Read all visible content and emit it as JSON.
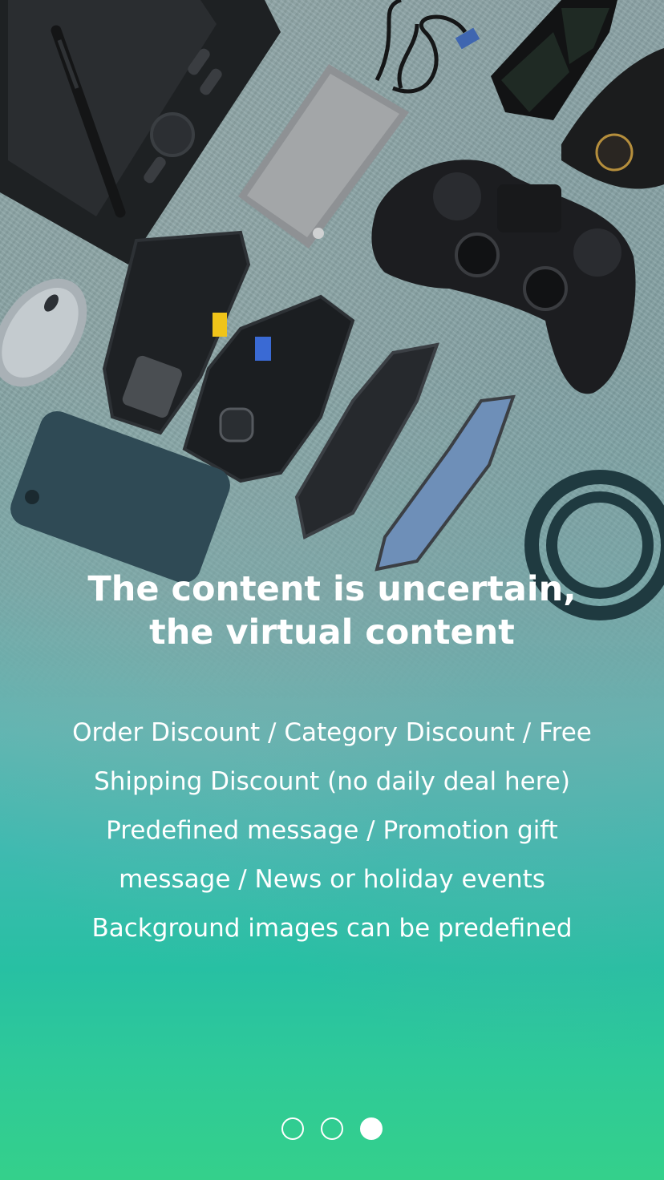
{
  "onboarding": {
    "title_line1": "The content is uncertain,",
    "title_line2": "the virtual content",
    "body_lines": [
      "Order Discount / Category Discount / Free",
      "Shipping Discount (no daily deal here)",
      "Predefined message / Promotion gift",
      "message / News or holiday events",
      "Background images can be predefined"
    ],
    "page_indicator": {
      "total": 3,
      "current": 3
    }
  },
  "colors": {
    "gradient_top": "#8ea4a6",
    "gradient_mid": "#3fbab0",
    "gradient_bottom": "#34d08b",
    "text": "#ffffff"
  },
  "hero_image": {
    "items": [
      "drawing-tablet",
      "stylus-pen",
      "external-hard-drive",
      "usb-cable",
      "sunglasses",
      "glasses-case",
      "game-controller",
      "computer-mouse",
      "phone-frame-parts",
      "smartphone",
      "cable-coil"
    ]
  }
}
